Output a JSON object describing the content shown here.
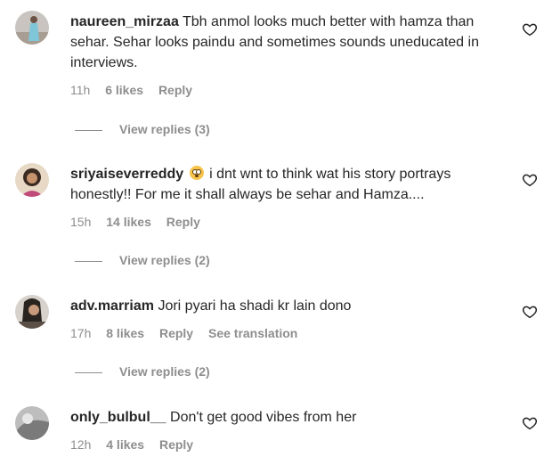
{
  "comments": [
    {
      "username": "naureen_mirzaa",
      "text": "Tbh anmol looks much better with hamza than sehar. Sehar looks paindu and sometimes sounds uneducated in interviews.",
      "time": "11h",
      "likes": "6 likes",
      "reply": "Reply",
      "view_replies": "View replies (3)"
    },
    {
      "username": "sriyaiseverreddy",
      "emoji": "flushed-face-emoji",
      "text": "i dnt wnt to think wat his story portrays honestly!! For me it shall always be sehar and Hamza....",
      "time": "15h",
      "likes": "14 likes",
      "reply": "Reply",
      "view_replies": "View replies (2)"
    },
    {
      "username": "adv.marriam",
      "text": "Jori pyari ha shadi kr lain dono",
      "time": "17h",
      "likes": "8 likes",
      "reply": "Reply",
      "see_translation": "See translation",
      "view_replies": "View replies (2)"
    },
    {
      "username": "only_bulbul__",
      "text": "Don't get good vibes from her",
      "time": "12h",
      "likes": "4 likes",
      "reply": "Reply"
    }
  ],
  "icons": {
    "like": "heart-outline-icon"
  },
  "colors": {
    "text": "#262626",
    "muted": "#8e8e8e"
  }
}
